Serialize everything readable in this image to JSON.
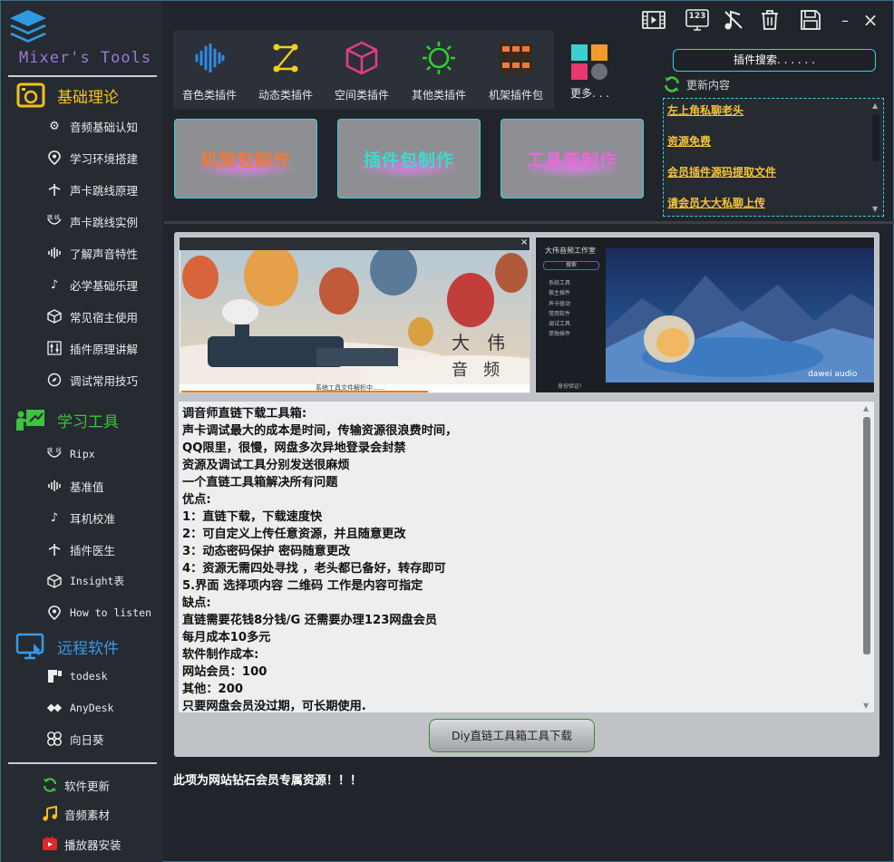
{
  "brand": {
    "name": "Mixer's Tools"
  },
  "sidebar": {
    "sections": [
      {
        "label": "基础理论",
        "color": "#f2c21b",
        "icon": "speaker-box-icon"
      },
      {
        "label": "学习工具",
        "color": "#3cc43c",
        "icon": "teacher-board-icon"
      },
      {
        "label": "远程软件",
        "color": "#3a9ae8",
        "icon": "remote-monitor-icon"
      }
    ],
    "theory_items": [
      {
        "label": "音频基础认知",
        "icon": "gear-icon"
      },
      {
        "label": "学习环境搭建",
        "icon": "location-pin-icon"
      },
      {
        "label": "声卡跳线原理",
        "icon": "antenna-icon"
      },
      {
        "label": "声卡跳线实例",
        "icon": "jumper-icon"
      },
      {
        "label": "了解声音特性",
        "icon": "waveform-icon"
      },
      {
        "label": "必学基础乐理",
        "icon": "music-note-icon"
      },
      {
        "label": "常见宿主使用",
        "icon": "cube-icon"
      },
      {
        "label": "插件原理讲解",
        "icon": "sliders-icon"
      },
      {
        "label": "调试常用技巧",
        "icon": "compass-icon"
      }
    ],
    "tool_items": [
      {
        "label": "Ripx",
        "icon": "jumper-icon"
      },
      {
        "label": "基准值",
        "icon": "waveform-icon"
      },
      {
        "label": "耳机校准",
        "icon": "music-note-icon"
      },
      {
        "label": "插件医生",
        "icon": "antenna-icon"
      },
      {
        "label": "Insight表",
        "icon": "cube-icon"
      },
      {
        "label": "How to listen",
        "icon": "location-pin-icon"
      }
    ],
    "remote_items": [
      {
        "label": "todesk",
        "icon": "todesk-icon"
      },
      {
        "label": "AnyDesk",
        "icon": "anydesk-icon"
      },
      {
        "label": "向日葵",
        "icon": "sunflower-icon"
      }
    ],
    "bottom_items": [
      {
        "label": "软件更新",
        "icon": "refresh-icon"
      },
      {
        "label": "音频素材",
        "icon": "music-note-icon"
      },
      {
        "label": "播放器安装",
        "icon": "play-icon"
      }
    ]
  },
  "toolbar": {
    "icons": [
      "video-icon",
      "counter-123-icon",
      "mute-note-icon",
      "trash-icon",
      "save-icon"
    ],
    "counter_text": "123",
    "minimize": "–",
    "close": "×"
  },
  "plugins": {
    "categories": [
      {
        "label": "音色类插件",
        "icon": "soundwave-icon"
      },
      {
        "label": "动态类插件",
        "icon": "node-link-icon"
      },
      {
        "label": "空间类插件",
        "icon": "cube-outline-icon"
      },
      {
        "label": "其他类插件",
        "icon": "sun-icon"
      },
      {
        "label": "机架插件包",
        "icon": "rack-icon"
      }
    ],
    "more_label": "更多. . ."
  },
  "big_buttons": [
    {
      "label": "机架包制作",
      "color": "#f07a3a"
    },
    {
      "label": "插件包制作",
      "color": "#40d8d0"
    },
    {
      "label": "工具箱制作",
      "color": "#e86ad8"
    }
  ],
  "search": {
    "placeholder": "插件搜索. . . . . ."
  },
  "updates": {
    "title": "更新内容",
    "items": [
      "左上角私聊老头",
      "资源免费",
      "会员插件源码提取文件",
      "请会员大大私聊上传"
    ]
  },
  "screenshots": {
    "left": {
      "status": "系统工具文件解析中......",
      "watermark": [
        "大",
        "伟",
        "音",
        "频"
      ]
    },
    "right": {
      "title": "大伟音频工作室",
      "search_label": "搜索",
      "menu": [
        "系统工具",
        "宿主插件",
        "声卡驱动",
        "常用软件",
        "调试工具",
        "单独插件"
      ],
      "footer": "身份验证!",
      "brand": "dawei audio"
    }
  },
  "description": {
    "lines": [
      "调音师直链下载工具箱:",
      "声卡调试最大的成本是时间，传输资源很浪费时间，",
      "QQ限里，很慢，网盘多次异地登录会封禁",
      "资源及调试工具分别发送很麻烦",
      "一个直链工具箱解决所有问题",
      "优点:",
      "1：直链下载，下载速度快",
      "2：可自定义上传任意资源，并且随意更改",
      "3：动态密码保护 密码随意更改",
      "4：资源无需四处寻找 ，老头都已备好，转存即可",
      "5.界面 选择项内容 二维码 工作是内容可指定",
      "缺点:",
      "直链需要花钱8分钱/G 还需要办理123网盘会员",
      "每月成本10多元",
      "软件制作成本:",
      "网站会员：100",
      "其他：200",
      "只要网盘会员没过期，可长期使用."
    ]
  },
  "download_button": {
    "label": "Diy直链工具箱工具下载"
  },
  "footer_note": "此项为网站钻石会员专属资源！！！"
}
